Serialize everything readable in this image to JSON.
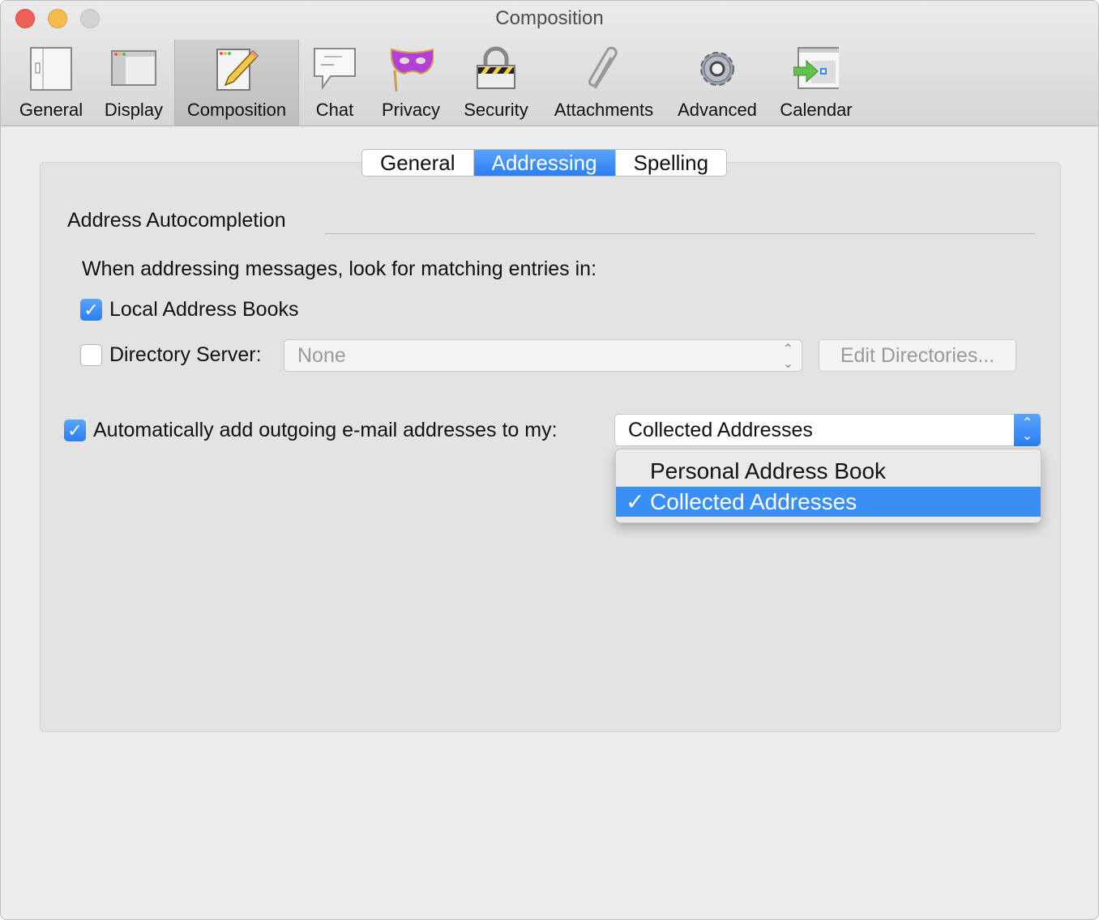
{
  "window": {
    "title": "Composition"
  },
  "toolbar": {
    "items": [
      {
        "label": "General",
        "icon": "general-icon"
      },
      {
        "label": "Display",
        "icon": "display-icon"
      },
      {
        "label": "Composition",
        "icon": "pencil-icon",
        "selected": true
      },
      {
        "label": "Chat",
        "icon": "chat-icon"
      },
      {
        "label": "Privacy",
        "icon": "mask-icon"
      },
      {
        "label": "Security",
        "icon": "lock-icon"
      },
      {
        "label": "Attachments",
        "icon": "paperclip-icon"
      },
      {
        "label": "Advanced",
        "icon": "gear-icon"
      },
      {
        "label": "Calendar",
        "icon": "calendar-icon"
      }
    ]
  },
  "tabs": [
    {
      "label": "General"
    },
    {
      "label": "Addressing",
      "selected": true
    },
    {
      "label": "Spelling"
    }
  ],
  "section": {
    "title": "Address Autocompletion",
    "description": "When addressing messages, look for matching entries in:"
  },
  "local_books": {
    "label": "Local Address Books",
    "checked": true
  },
  "directory": {
    "label": "Directory Server:",
    "checked": false,
    "value": "None",
    "edit_button": "Edit Directories..."
  },
  "auto_add": {
    "label": "Automatically add outgoing e-mail addresses to my:",
    "checked": true,
    "value": "Collected Addresses"
  },
  "dropdown": {
    "options": [
      "Personal Address Book",
      "Collected Addresses"
    ],
    "selected_index": 1,
    "check": "✓"
  },
  "colors": {
    "accent": "#2a7ef3",
    "highlight": "#3a8ff6"
  }
}
